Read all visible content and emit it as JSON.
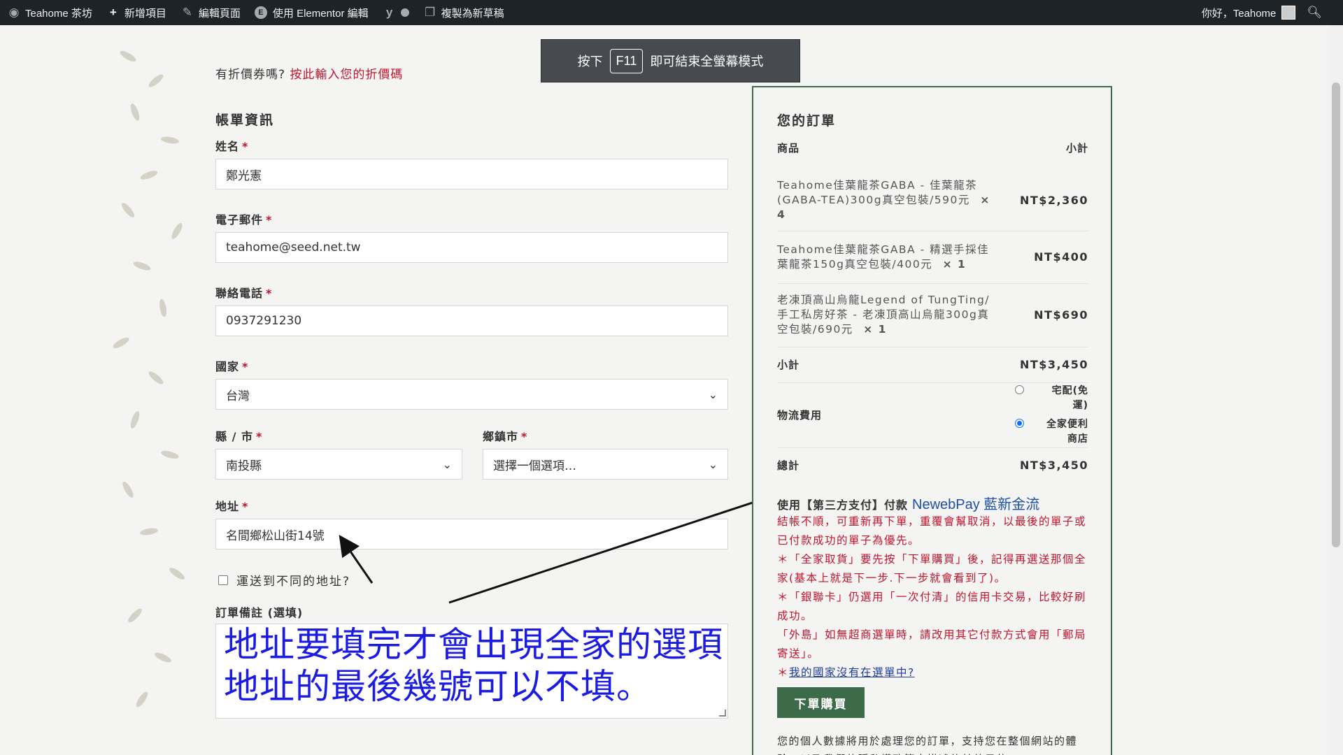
{
  "admin_bar": {
    "site_name": "Teahome 茶坊",
    "new_item": "新增項目",
    "edit_page": "編輯頁面",
    "elementor_edit": "使用 Elementor 編輯",
    "copy_draft": "複製為新草稿",
    "greeting": "你好，Teahome"
  },
  "toast": {
    "prefix": "按下",
    "key": "F11",
    "suffix": "即可結束全螢幕模式"
  },
  "coupon": {
    "question": "有折價券嗎?",
    "link": "按此輸入您的折價碼"
  },
  "billing": {
    "title": "帳單資訊",
    "required_mark": "*",
    "name_label": "姓名",
    "name_value": "鄭光憲",
    "email_label": "電子郵件",
    "email_value": "teahome@seed.net.tw",
    "phone_label": "聯絡電話",
    "phone_value": "0937291230",
    "country_label": "國家",
    "country_value": "台灣",
    "county_label": "縣 / 市",
    "county_value": "南投縣",
    "township_label": "鄉鎮市",
    "township_value": "選擇一個選項…",
    "address_label": "地址",
    "address_value": "名間鄉松山街14號",
    "ship_different": "運送到不同的地址?",
    "notes_label": "訂單備註 (選填)"
  },
  "annotation": {
    "line1": "地址要填完才會出現全家的選項",
    "line2": "地址的最後幾號可以不填。"
  },
  "order": {
    "title": "您的訂單",
    "col_product": "商品",
    "col_subtotal": "小計",
    "items": [
      {
        "name": "Teahome佳葉龍茶GABA - 佳葉龍茶(GABA-TEA)300g真空包裝/590元",
        "qty": "× 4",
        "price": "NT$2,360"
      },
      {
        "name": "Teahome佳葉龍茶GABA - 精選手採佳葉龍茶150g真空包裝/400元",
        "qty": "× 1",
        "price": "NT$400"
      },
      {
        "name": "老凍頂高山烏龍Legend of TungTing/手工私房好茶 - 老凍頂高山烏龍300g真空包裝/690元",
        "qty": "× 1",
        "price": "NT$690"
      }
    ],
    "subtotal_label": "小計",
    "subtotal_value": "NT$3,450",
    "shipping_label": "物流費用",
    "shipping_options": [
      {
        "label": "宅配(免運)",
        "selected": false
      },
      {
        "label": "全家便利商店",
        "selected": true
      }
    ],
    "total_label": "總計",
    "total_value": "NT$3,450",
    "payment_title": "使用【第三方支付】付款",
    "payment_brand": "NewebPay 藍新金流",
    "notes": {
      "n1": "結帳不順，可重新再下單，重覆會幫取消，以最後的單子或已付款成功的單子為優先。",
      "n2": "＊「全家取貨」要先按「下單購買」後，記得再選送那個全家(基本上就是下一步.下一步就會看到了)。",
      "n3": "＊「銀聯卡」仍選用「一次付清」的信用卡交易，比較好刷成功。",
      "n4": "「外島」如無超商選單時，請改用其它付款方式會用「郵局寄送」。",
      "n5_prefix": "＊",
      "n5_link": "我的國家沒有在選單中?"
    },
    "place_order": "下單購買",
    "privacy": "您的個人數據將用於處理您的訂單，支持您在整個網站的體驗，以及我們的隱私權政策中描述的其他目的。"
  },
  "colors": {
    "accent_green": "#3d6b4a",
    "required_red": "#c0152f",
    "annotation_blue": "#1c1ce0",
    "admin_bar": "#1d2327"
  }
}
